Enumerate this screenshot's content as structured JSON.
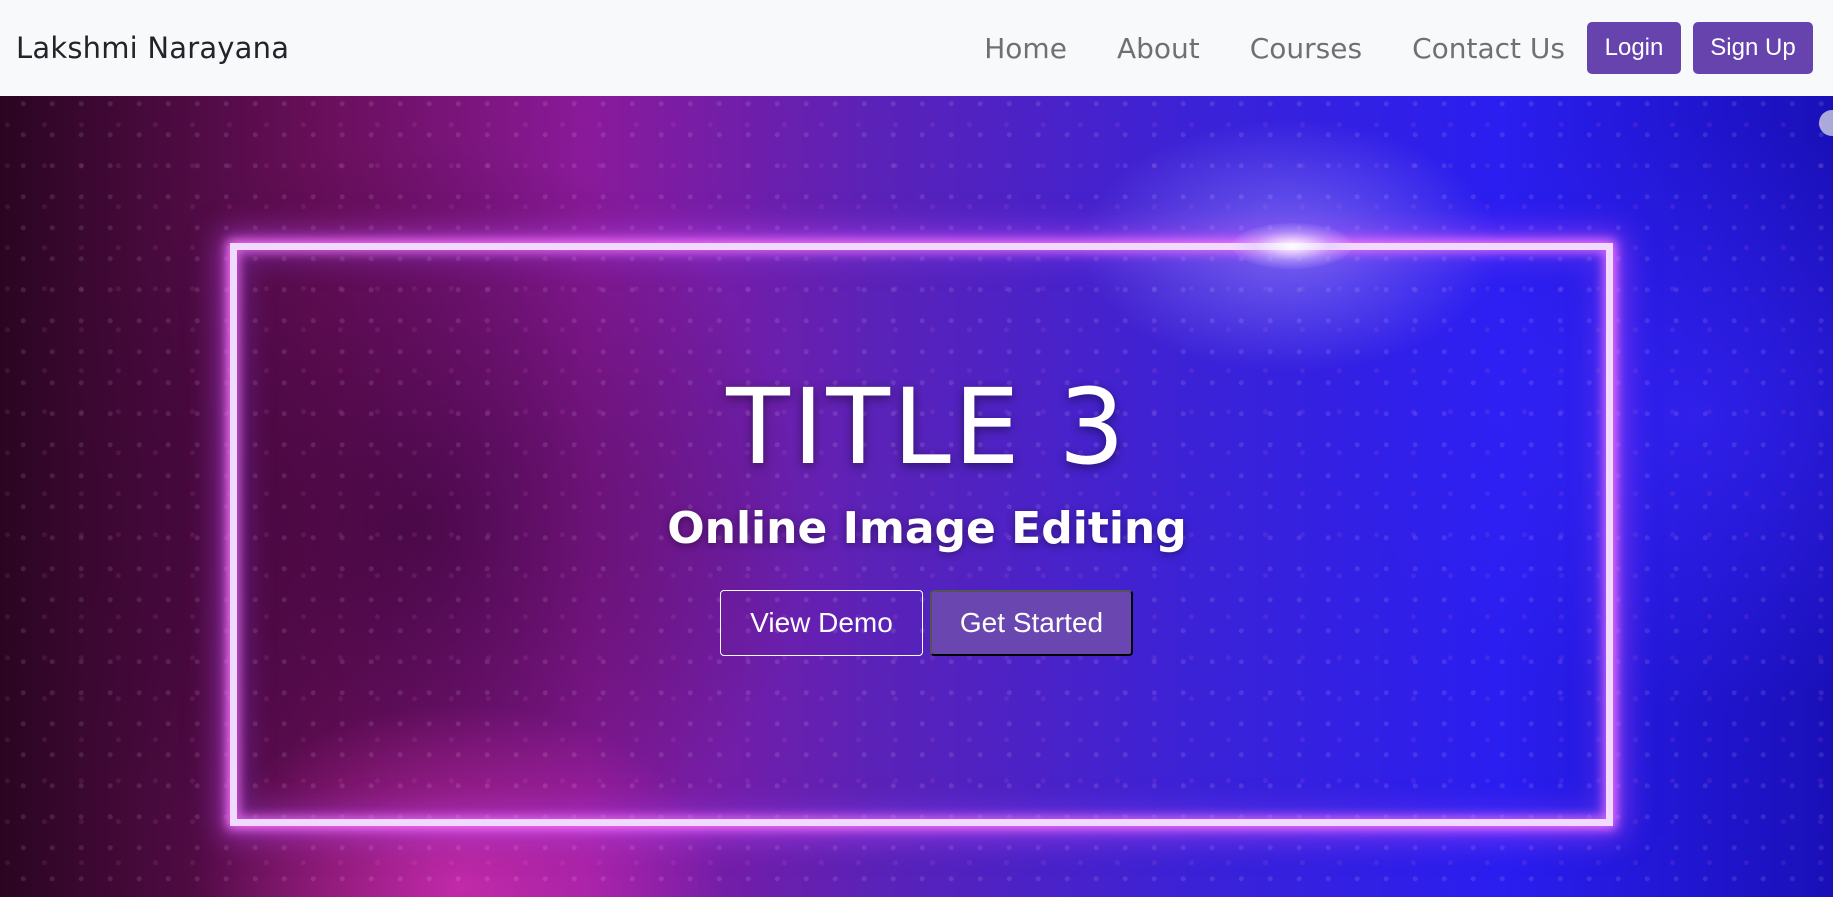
{
  "navbar": {
    "brand": "Lakshmi Narayana",
    "links": [
      "Home",
      "About",
      "Courses",
      "Contact Us"
    ],
    "login_label": "Login",
    "signup_label": "Sign Up",
    "button_color": "#6643ad"
  },
  "hero": {
    "title": "TITLE 3",
    "subtitle": "Online Image Editing",
    "view_demo_label": "View Demo",
    "get_started_label": "Get Started",
    "primary_color": "#6a46b0"
  }
}
